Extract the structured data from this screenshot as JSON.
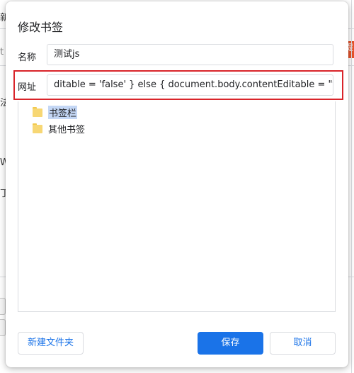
{
  "dialog": {
    "title": "修改书签",
    "name_label": "名称",
    "name_value": "测试js",
    "url_label": "网址",
    "url_value": "ditable = 'false' } else { document.body.contentEditable = \"true\" } })()",
    "folders": [
      {
        "label": "书签栏",
        "selected": true
      },
      {
        "label": "其他书签",
        "selected": false
      }
    ],
    "buttons": {
      "new_folder": "新建文件夹",
      "save": "保存",
      "cancel": "取消"
    }
  },
  "background": {
    "frag_top": "新",
    "frag_left_1": "t",
    "frag_left_2": "法",
    "frag_left_3": "W",
    "frag_left_4": "丁",
    "frag_right_tab": "提"
  },
  "colors": {
    "accent": "#1a73e8",
    "highlight_border": "#d9242a",
    "folder_yellow": "#f7d774"
  }
}
